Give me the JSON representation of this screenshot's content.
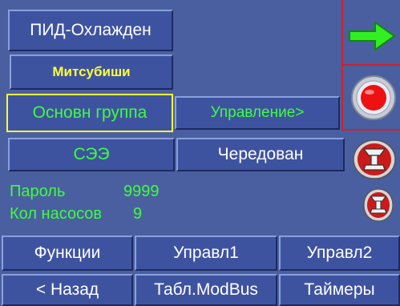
{
  "header": {
    "title_button": "ПИД-Охлажден",
    "brand_button": "Митсубиши"
  },
  "mode": {
    "group_button": "Основн группа",
    "control_button": "Управление>"
  },
  "row2": {
    "left_button": "СЭЭ",
    "right_button": "Чередован"
  },
  "info": {
    "password_label": "Пароль",
    "password_value": "9999",
    "pumps_label": "Кол насосов",
    "pumps_value": "9"
  },
  "nav_row1": {
    "functions": "Функции",
    "control1": "Управл1",
    "control2": "Управл2"
  },
  "nav_row2": {
    "back": "< Назад",
    "modbus": "Табл.ModBus",
    "timers": "Таймеры"
  },
  "icons": {
    "forward": "green-arrow-right-icon",
    "stop": "red-stop-button-icon",
    "pump1": "pump-alarm-icon",
    "pump2": "pump-alarm-icon"
  },
  "colors": {
    "background": "#4a5fa0",
    "text_green": "#3cff3c",
    "text_yellow": "#ffff33",
    "panel_red": "#d0202a"
  }
}
